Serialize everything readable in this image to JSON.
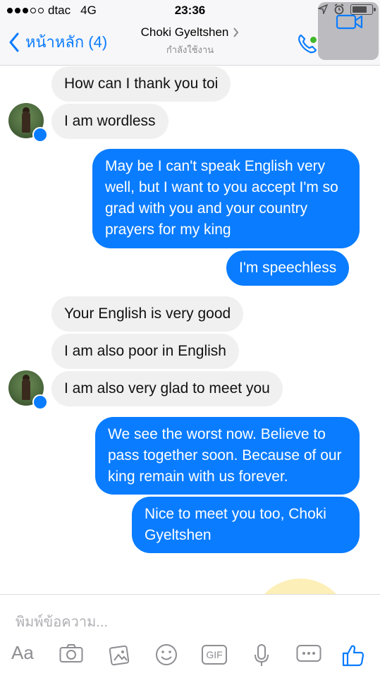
{
  "status_bar": {
    "carrier": "dtac",
    "network": "4G",
    "time": "23:36"
  },
  "nav": {
    "back_label": "หน้าหลัก (4)",
    "contact_name": "Choki Gyeltshen",
    "status_text": "กำลังใช้งาน"
  },
  "messages": [
    {
      "side": "in",
      "text": "How can I thank you toi"
    },
    {
      "side": "in",
      "text": "I am wordless"
    },
    {
      "side": "out",
      "text": "May be I can't speak English very well, but I want to you accept I'm so grad with you and your country  prayers for my king"
    },
    {
      "side": "out",
      "text": "I'm speechless"
    },
    {
      "side": "in",
      "text": "Your English is very good"
    },
    {
      "side": "in",
      "text": "I am also poor in English"
    },
    {
      "side": "in",
      "text": "I am also very glad to meet you"
    },
    {
      "side": "out",
      "text": "We see the worst now. Believe to pass together soon. Because of our king remain with us forever."
    },
    {
      "side": "out",
      "text": "Nice to meet you too, Choki Gyeltshen"
    }
  ],
  "composer": {
    "placeholder": "พิมพ์ข้อความ..."
  },
  "toolbar": {
    "text_label": "Aa",
    "gif_label": "GIF"
  },
  "colors": {
    "accent": "#0a7cff",
    "incoming_bubble": "#f1f0f0",
    "online": "#42b72a"
  }
}
